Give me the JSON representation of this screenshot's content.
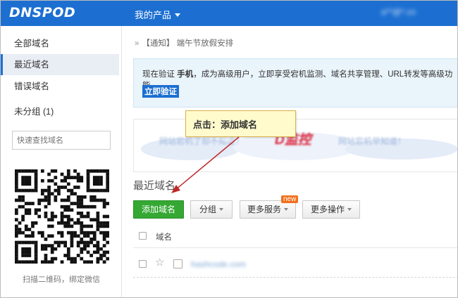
{
  "header": {
    "logo": "DNSPOD",
    "product_menu": "我的产品",
    "user_account": "a**@*.cn"
  },
  "sidebar": {
    "items": [
      {
        "label": "全部域名",
        "active": false
      },
      {
        "label": "最近域名",
        "active": true
      },
      {
        "label": "错误域名",
        "active": false
      },
      {
        "label": "未分组 (1)",
        "active": false
      }
    ],
    "search_placeholder": "快速查找域名",
    "qr_caption": "扫描二维码，绑定微信"
  },
  "notice": {
    "prefix": "»",
    "text": "【通知】 端午节放假安排"
  },
  "info_box": {
    "text_before": "现在验证 ",
    "text_bold": "手机",
    "text_after": "，成为高级用户，立即享受宕机监测、域名共享管理、URL转发等高级功能。",
    "verify_link": "立即验证"
  },
  "banner": {
    "left_text": "网站宕机了却不知道？",
    "logo_main": "D",
    "logo_sub": "监控",
    "right_text": "网站宕机早知道！"
  },
  "callout": {
    "text": "点击：添加域名"
  },
  "section": {
    "title": "最近域名"
  },
  "toolbar": {
    "add_label": "添加域名",
    "group_label": "分组",
    "more_services_label": "更多服务",
    "more_ops_label": "更多操作",
    "new_badge": "new"
  },
  "table": {
    "header_domain": "域名",
    "rows": [
      {
        "domain": "hashcode.com"
      }
    ]
  },
  "colors": {
    "brand_blue": "#1c6fd1",
    "add_green": "#34a833",
    "callout_bg": "#fffbcc",
    "badge_orange": "#f0701e",
    "arrow_red": "#c0282a"
  }
}
